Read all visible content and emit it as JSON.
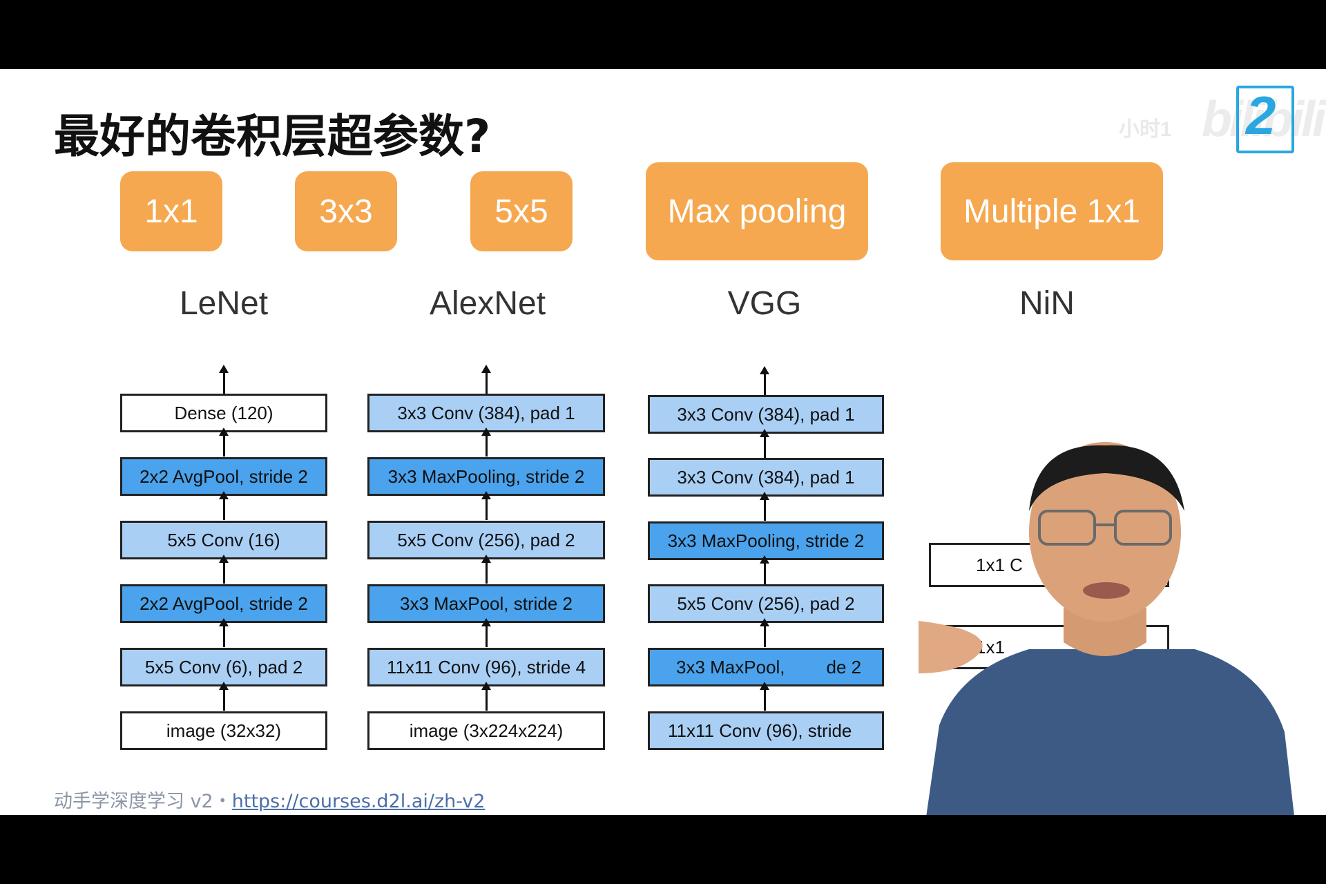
{
  "title": "最好的卷积层超参数?",
  "hyperparams": [
    "1x1",
    "3x3",
    "5x5",
    "Max pooling",
    "Multiple 1x1"
  ],
  "networks": {
    "lenet": {
      "label": "LeNet",
      "layers": [
        "Dense (120)",
        "2x2 AvgPool, stride 2",
        "5x5 Conv (16)",
        "2x2 AvgPool, stride 2",
        "5x5 Conv (6), pad 2",
        "image (32x32)"
      ]
    },
    "alexnet": {
      "label": "AlexNet",
      "layers": [
        "3x3 Conv (384), pad 1",
        "3x3 MaxPooling, stride 2",
        "5x5 Conv (256), pad 2",
        "3x3 MaxPool, stride 2",
        "11x11 Conv (96), stride 4",
        "image (3x224x224)"
      ]
    },
    "vgg": {
      "label": "VGG",
      "layers": [
        "3x3 Conv (384), pad 1",
        "3x3 Conv (384), pad 1",
        "3x3 MaxPooling, stride 2",
        "5x5 Conv (256), pad 2",
        "3x3 MaxPool, ",
        "11x11 Conv (96), stride"
      ],
      "layer_tails": [
        "",
        "",
        "",
        "",
        "de 2",
        ""
      ]
    },
    "nin": {
      "label": "NiN",
      "layers": [
        "1x1 C",
        "1x1"
      ]
    }
  },
  "footer": {
    "text": "动手学深度学习 v2・",
    "link": "https://courses.d2l.ai/zh-v2"
  },
  "watermark": {
    "text": "bilibili"
  },
  "logo_color": "#2aa7e0",
  "button_color": "#f5a84f"
}
